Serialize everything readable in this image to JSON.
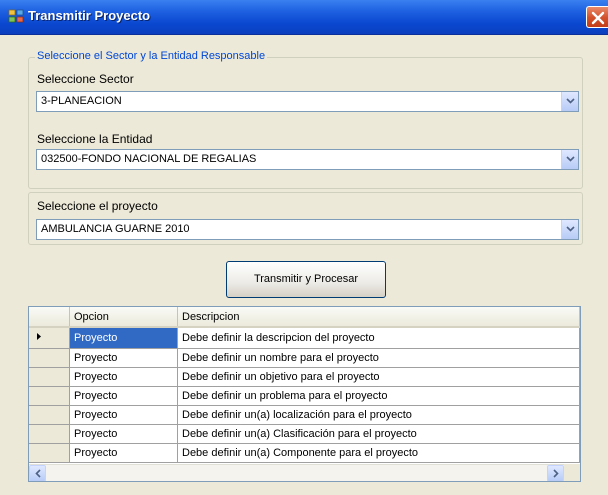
{
  "window": {
    "title": "Transmitir Proyecto"
  },
  "group": {
    "legend": "Seleccione el Sector y la Entidad Responsable"
  },
  "sector": {
    "label": "Seleccione Sector",
    "value": "3-PLANEACION"
  },
  "entidad": {
    "label": "Seleccione la Entidad",
    "value": "032500-FONDO NACIONAL DE REGALIAS"
  },
  "proyecto": {
    "label": "Seleccione el proyecto",
    "value": "AMBULANCIA GUARNE 2010"
  },
  "action": {
    "label": "Transmitir y Procesar"
  },
  "grid": {
    "headers": [
      "Opcion",
      "Descripcion"
    ],
    "rows": [
      {
        "opcion": "Proyecto",
        "descripcion": "Debe definir la descripcion del proyecto"
      },
      {
        "opcion": "Proyecto",
        "descripcion": "Debe definir un nombre para el  proyecto"
      },
      {
        "opcion": "Proyecto",
        "descripcion": "Debe definir un objetivo para el proyecto"
      },
      {
        "opcion": "Proyecto",
        "descripcion": "Debe definir un problema para el proyecto"
      },
      {
        "opcion": "Proyecto",
        "descripcion": "Debe definir un(a) localización para el proyecto"
      },
      {
        "opcion": "Proyecto",
        "descripcion": "Debe definir un(a) Clasificación para el proyecto"
      },
      {
        "opcion": "Proyecto",
        "descripcion": "Debe definir un(a) Componente para el proyecto"
      }
    ]
  },
  "colors": {
    "title_bar": "#0a48d0",
    "selection": "#316ac5",
    "group_legend": "#0046d5",
    "window_bg": "#ece9d8"
  },
  "icons": {
    "app": "app-icon",
    "close": "close-icon",
    "dropdown": "chevron-down-icon",
    "row_pointer": "row-pointer-icon"
  }
}
